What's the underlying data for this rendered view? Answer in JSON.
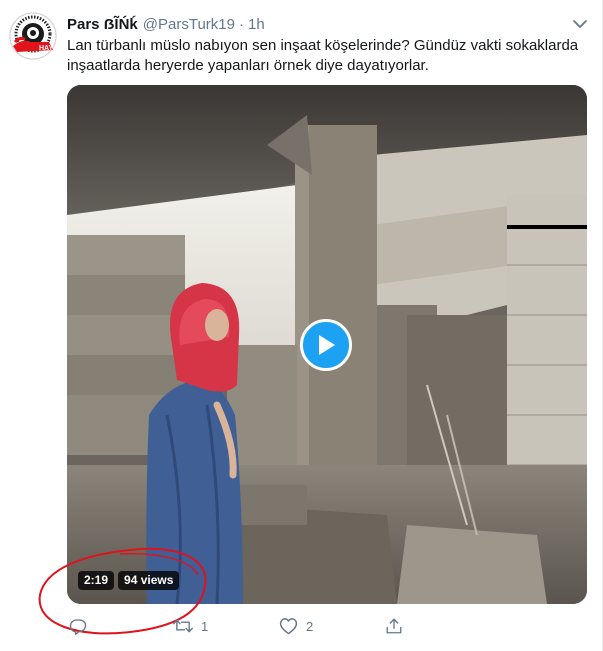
{
  "tweet": {
    "display_name": "Pars ẞĨŃḱ",
    "handle": "@ParsTurk19",
    "separator": "·",
    "time": "1h",
    "text_lines": [
      "Lan türbanlı müslo nabıyon sen inşaat köşelerinde? Gündüz vakti sokaklarda",
      "inşaatlarda heryerde yapanları örnek diye dayatıyorlar."
    ]
  },
  "avatar": {
    "icon": "circular-logo-avatar",
    "banner_text": "HAY"
  },
  "video": {
    "duration": "2:19",
    "views": "94 views",
    "play_icon": "play-icon"
  },
  "actions": {
    "reply": {
      "icon": "reply-icon",
      "count": ""
    },
    "retweet": {
      "icon": "retweet-icon",
      "count": "1"
    },
    "like": {
      "icon": "heart-icon",
      "count": "2"
    },
    "share": {
      "icon": "share-icon"
    }
  },
  "colors": {
    "accent": "#1da1f2",
    "secondary_text": "#657786",
    "annotation_red": "#e0121b"
  }
}
